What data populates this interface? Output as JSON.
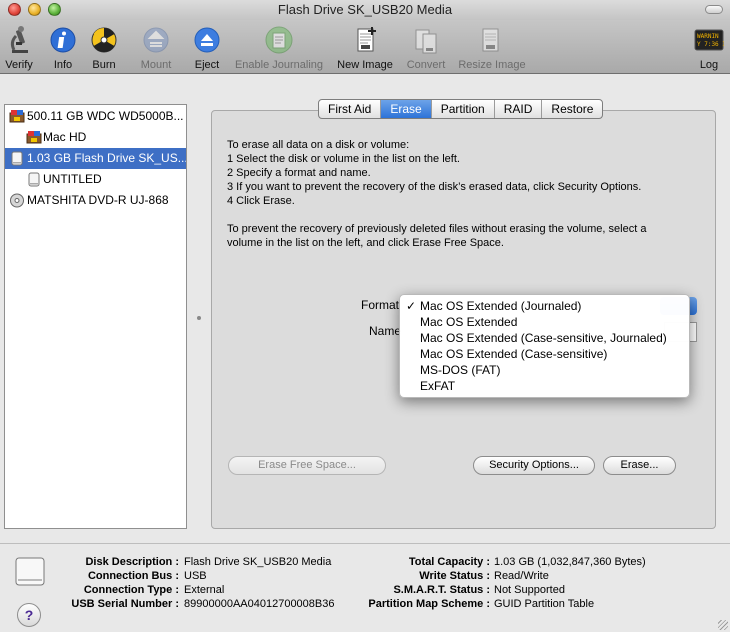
{
  "window": {
    "title": "Flash Drive SK_USB20 Media"
  },
  "toolbar": {
    "items": [
      {
        "label": "Verify",
        "icon": "microscope-icon",
        "enabled": true
      },
      {
        "label": "Info",
        "icon": "info-icon",
        "enabled": true
      },
      {
        "label": "Burn",
        "icon": "burn-icon",
        "enabled": true
      },
      {
        "label": "Mount",
        "icon": "mount-icon",
        "enabled": false
      },
      {
        "label": "Eject",
        "icon": "eject-icon",
        "enabled": true
      },
      {
        "label": "Enable Journaling",
        "icon": "journal-icon",
        "enabled": false
      },
      {
        "label": "New Image",
        "icon": "new-image-icon",
        "enabled": true
      },
      {
        "label": "Convert",
        "icon": "convert-icon",
        "enabled": false
      },
      {
        "label": "Resize Image",
        "icon": "resize-image-icon",
        "enabled": false
      }
    ],
    "log": {
      "label": "Log",
      "icon": "log-icon",
      "icon_text": "WARNIN\nY 7:36 I"
    }
  },
  "devices": [
    {
      "label": "500.11 GB WDC WD5000B...",
      "icon": "hard-disk-icon",
      "level": 0
    },
    {
      "label": "Mac HD",
      "icon": "volume-icon",
      "level": 1
    },
    {
      "label": "1.03 GB Flash Drive SK_US...",
      "icon": "usb-drive-icon",
      "level": 0,
      "selected": true
    },
    {
      "label": "UNTITLED",
      "icon": "volume-icon",
      "level": 1
    },
    {
      "label": "MATSHITA DVD-R UJ-868",
      "icon": "optical-drive-icon",
      "level": 0
    }
  ],
  "tabs": [
    "First Aid",
    "Erase",
    "Partition",
    "RAID",
    "Restore"
  ],
  "active_tab": "Erase",
  "erase": {
    "instructions": [
      "To erase all data on a disk or volume:",
      "1 Select the disk or volume in the list on the left.",
      "2 Specify a format and name.",
      "3 If you want to prevent the recovery of the disk’s erased data, click Security Options.",
      "4 Click Erase."
    ],
    "free_space_note": [
      "To prevent the recovery of previously deleted files without erasing the volume, select a",
      "volume in the list on the left, and click Erase Free Space."
    ],
    "format_label": "Format",
    "name_label": "Name",
    "format_options": [
      "Mac OS Extended (Journaled)",
      "Mac OS Extended",
      "Mac OS Extended (Case-sensitive, Journaled)",
      "Mac OS Extended (Case-sensitive)",
      "MS-DOS (FAT)",
      "ExFAT"
    ],
    "selected_format": "Mac OS Extended (Journaled)",
    "check_mark": "✓",
    "buttons": {
      "erase_free_space": "Erase Free Space...",
      "security_options": "Security Options...",
      "erase": "Erase..."
    }
  },
  "details": {
    "left": [
      {
        "key": "Disk Description :",
        "value": "Flash Drive SK_USB20 Media"
      },
      {
        "key": "Connection Bus :",
        "value": "USB"
      },
      {
        "key": "Connection Type :",
        "value": "External"
      },
      {
        "key": "USB Serial Number :",
        "value": "89900000AA04012700008B36"
      }
    ],
    "right": [
      {
        "key": "Total Capacity :",
        "value": "1.03 GB (1,032,847,360 Bytes)"
      },
      {
        "key": "Write Status :",
        "value": "Read/Write"
      },
      {
        "key": "S.M.A.R.T. Status :",
        "value": "Not Supported"
      },
      {
        "key": "Partition Map Scheme :",
        "value": "GUID Partition Table"
      }
    ]
  },
  "help_label": "?"
}
